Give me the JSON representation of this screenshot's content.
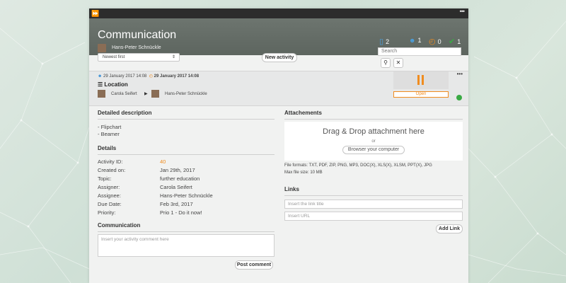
{
  "window": {
    "expand_icon": "fast-forward-icon",
    "menu_icon": "dots-icon"
  },
  "header": {
    "title": "Communication",
    "owner": "Hans-Peter Schnückle",
    "stats": [
      {
        "icon": "chat-icon",
        "glyph": "💬",
        "value": "2",
        "color": "#4a9fdc"
      },
      {
        "icon": "users-icon",
        "glyph": "👥",
        "value": "1",
        "color": "#4a9fdc"
      },
      {
        "icon": "clock-icon",
        "glyph": "◔",
        "value": "0",
        "color": "#f08c1f"
      },
      {
        "icon": "check-icon",
        "glyph": "✔",
        "value": "1",
        "color": "#3aaa44"
      }
    ]
  },
  "toolbar": {
    "sort_value": "Newest first",
    "new_activity_label": "New activity",
    "search_placeholder": "Search",
    "search_icon": "🔍",
    "clear_icon": "✕"
  },
  "activity": {
    "created": "29 January 2017 14:08",
    "due": "29 January 2017 14:08",
    "title": "Location",
    "assigner": "Carola Seifert",
    "assignee": "Hans-Peter Schnückle",
    "status_label": "Open",
    "accent": "#f08c1f",
    "status_color": "#3aaa44"
  },
  "description": {
    "heading": "Detailed description",
    "lines": [
      "- Flipchart",
      "- Beamer"
    ]
  },
  "details": {
    "heading": "Details",
    "rows": [
      {
        "k": "Activity ID:",
        "v": "40"
      },
      {
        "k": "Created on:",
        "v": "Jan 29th, 2017"
      },
      {
        "k": "Topic:",
        "v": "further education"
      },
      {
        "k": "Assigner:",
        "v": "Carola Seifert"
      },
      {
        "k": "Assignee:",
        "v": "Hans-Peter Schnückle"
      },
      {
        "k": "Due Date:",
        "v": "Feb 3rd, 2017"
      },
      {
        "k": "Priority:",
        "v": "Prio 1 - Do it now!"
      }
    ]
  },
  "communication": {
    "heading": "Communication",
    "placeholder": "Insert your activity comment here",
    "post_label": "Post comment"
  },
  "attachments": {
    "heading": "Attachements",
    "drop_text": "Drag & Drop attachment here",
    "or_text": "or",
    "browse_label": "Browser your computer",
    "formats": "File formats: TXT, PDF, ZIP, PNG, MP3, DOC(X), XLS(X), XLSM, PPT(X), JPG",
    "max_size": "Max file size: 10 MB"
  },
  "links": {
    "heading": "Links",
    "title_placeholder": "Insert the link title",
    "url_placeholder": "Insert URL",
    "add_label": "Add Link"
  }
}
